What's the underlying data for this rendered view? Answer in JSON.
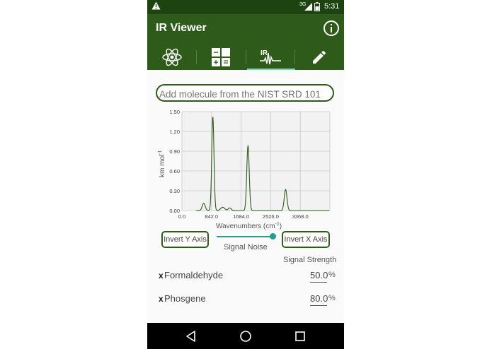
{
  "status": {
    "net": "3G",
    "time": "5:31"
  },
  "app": {
    "title": "IR Viewer"
  },
  "tabs": [
    {
      "name": "molecule",
      "icon": "molecule-icon"
    },
    {
      "name": "calculator",
      "icon": "calculator-icon"
    },
    {
      "name": "ir-spectrum",
      "icon": "ir-spectrum-icon",
      "selected": true
    },
    {
      "name": "edit",
      "icon": "pencil-icon"
    }
  ],
  "search": {
    "placeholder": "Add molecule from the NIST SRD 101"
  },
  "chart_data": {
    "type": "line",
    "xlabel": "Wavenumbers (cm",
    "xlabel_sup": "-1",
    "ylabel": "km mol",
    "ylabel_sup": "-1",
    "xlim": [
      0,
      4210
    ],
    "ylim": [
      0,
      1.5
    ],
    "xticks": [
      "0.0",
      "842.0",
      "1684.0",
      "2526.0",
      "3368.0"
    ],
    "yticks": [
      "1.50",
      "1.20",
      "0.90",
      "0.60",
      "0.30",
      "0.00"
    ],
    "grid": true,
    "color": "#2e5b1a",
    "peaks": [
      {
        "x": 620,
        "y": 0.11,
        "w": 60
      },
      {
        "x": 880,
        "y": 1.42,
        "w": 45
      },
      {
        "x": 1160,
        "y": 0.05,
        "w": 80
      },
      {
        "x": 1360,
        "y": 0.04,
        "w": 60
      },
      {
        "x": 1880,
        "y": 0.98,
        "w": 50
      },
      {
        "x": 2950,
        "y": 0.32,
        "w": 55
      }
    ]
  },
  "controls": {
    "invert_y": "Invert Y Axis",
    "invert_x": "Invert X Axis",
    "noise_label": "Signal Noise",
    "noise_value": 0.95,
    "strength_label": "Signal Strength"
  },
  "molecules": [
    {
      "remove": "x",
      "name": "Formaldehyde",
      "value": "50.0",
      "unit": "%"
    },
    {
      "remove": "x",
      "name": "Phosgene",
      "value": "80.0",
      "unit": "%"
    }
  ]
}
